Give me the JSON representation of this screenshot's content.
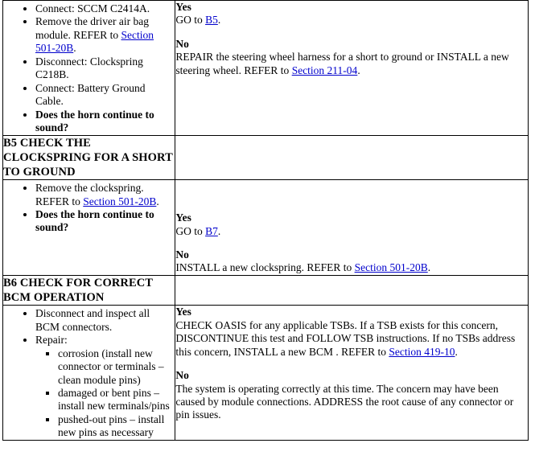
{
  "document": {
    "type": "pinpoint-test-table",
    "link_color": "#0000cc",
    "text_color": "#000000",
    "background": "#ffffff"
  },
  "rows": [
    {
      "id": "b4-continued",
      "actions": [
        {
          "text": "Connect: SCCM C2414A.",
          "bold": false
        },
        {
          "text": "Remove the driver air bag module. REFER to ",
          "link": "Section 501-20B",
          "after": ".",
          "bold": false
        },
        {
          "text": "Disconnect: Clockspring C218B.",
          "bold": false
        },
        {
          "text": "Connect: Battery Ground Cable.",
          "bold": false
        },
        {
          "text": "Does the horn continue to sound?",
          "bold": true
        }
      ],
      "results": [
        {
          "label": "Yes",
          "text": "GO to ",
          "link": "B5",
          "after": "."
        },
        {
          "label": "No",
          "text": "REPAIR the steering wheel harness for a short to ground or INSTALL a new steering wheel. REFER to ",
          "link": "Section 211-04",
          "after": "."
        }
      ]
    },
    {
      "id": "b5",
      "title": "B5 CHECK THE CLOCKSPRING FOR A SHORT TO GROUND",
      "actions": [
        {
          "text": "Remove the clockspring. REFER to ",
          "link": "Section 501-20B",
          "after": ".",
          "bold": false
        },
        {
          "text": "Does the horn continue to sound?",
          "bold": true
        }
      ],
      "results": [
        {
          "label": "Yes",
          "text": "GO to ",
          "link": "B7",
          "after": "."
        },
        {
          "label": "No",
          "text": "INSTALL a new clockspring. REFER to ",
          "link": "Section 501-20B",
          "after": "."
        }
      ]
    },
    {
      "id": "b6",
      "title": "B6 CHECK FOR CORRECT BCM OPERATION",
      "actions": [
        {
          "text": "Disconnect and inspect all BCM connectors.",
          "bold": false
        },
        {
          "text": "Repair:",
          "bold": false,
          "subitems": [
            "corrosion (install new connector or terminals – clean module pins)",
            "damaged or bent pins – install new terminals/pins",
            "pushed-out pins – install new pins as necessary"
          ]
        }
      ],
      "results": [
        {
          "label": "Yes",
          "text": "CHECK OASIS for any applicable TSBs. If a TSB exists for this concern, DISCONTINUE this test and FOLLOW TSB instructions. If no TSBs address this concern, INSTALL a new BCM . REFER to ",
          "link": "Section 419-10",
          "after": "."
        },
        {
          "label": "No",
          "text": "The system is operating correctly at this time. The concern may have been caused by module connections. ADDRESS the root cause of any connector or pin issues.",
          "link": "",
          "after": ""
        }
      ]
    }
  ]
}
